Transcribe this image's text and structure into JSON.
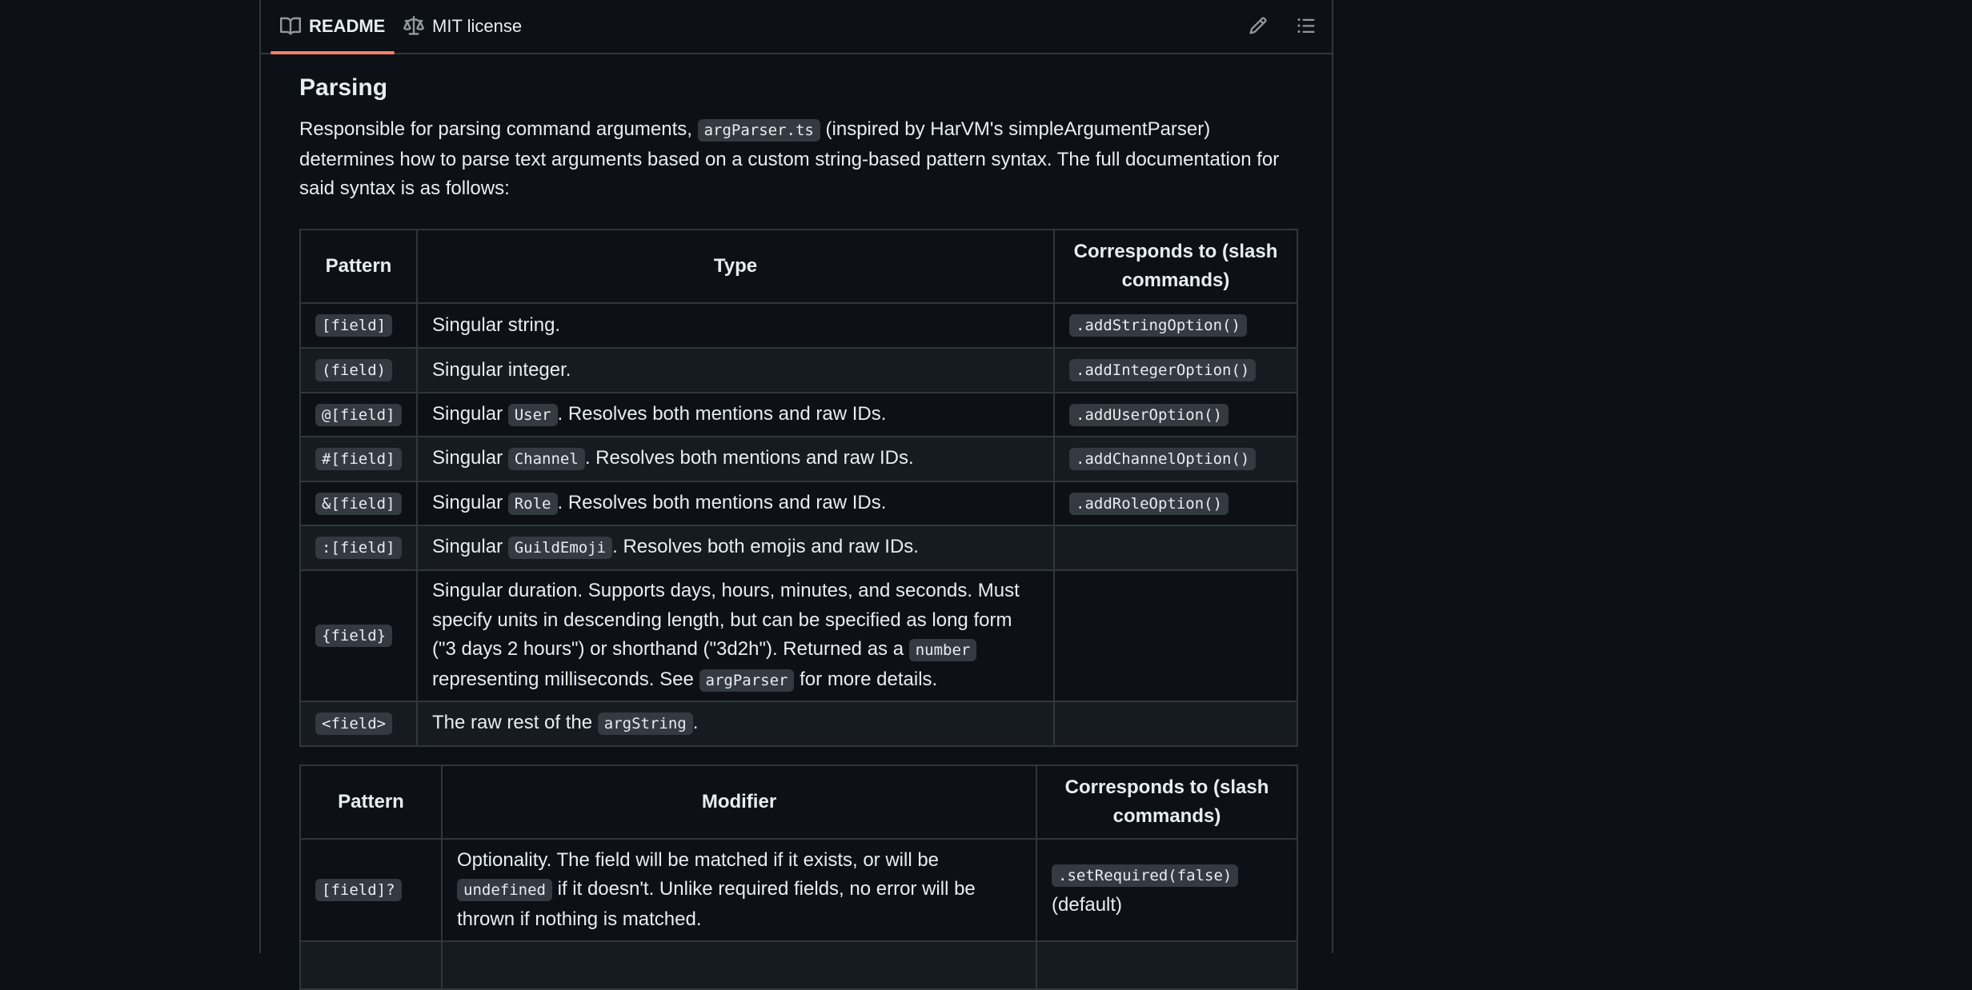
{
  "tabs": {
    "readme": "README",
    "license": "MIT license"
  },
  "icons": {
    "readme": "book-icon",
    "license": "scale-icon",
    "edit": "pencil-icon",
    "outline": "list-icon"
  },
  "colors": {
    "background": "#0d1117",
    "alt_row": "#161b22",
    "border": "#30363d",
    "code_bg": "#343942",
    "active_tab_underline": "#f78166"
  },
  "section": {
    "heading": "Parsing",
    "intro": {
      "t1": "Responsible for parsing command arguments, ",
      "code1": "argParser.ts",
      "t2": " (inspired by HarVM's simpleArgumentParser) determines how to parse text arguments based on a custom string-based pattern syntax. The full documentation for said syntax is as follows:"
    }
  },
  "types_table": {
    "headers": [
      "Pattern",
      "Type",
      "Corresponds to (slash commands)"
    ],
    "rows": [
      {
        "pattern": "[field]",
        "pre": "Singular string.",
        "code": "",
        "post": "",
        "slash": ".addStringOption()"
      },
      {
        "pattern": "(field)",
        "pre": "Singular integer.",
        "code": "",
        "post": "",
        "slash": ".addIntegerOption()"
      },
      {
        "pattern": "@[field]",
        "pre": "Singular ",
        "code": "User",
        "post": ". Resolves both mentions and raw IDs.",
        "slash": ".addUserOption()"
      },
      {
        "pattern": "#[field]",
        "pre": "Singular ",
        "code": "Channel",
        "post": ". Resolves both mentions and raw IDs.",
        "slash": ".addChannelOption()"
      },
      {
        "pattern": "&[field]",
        "pre": "Singular ",
        "code": "Role",
        "post": ". Resolves both mentions and raw IDs.",
        "slash": ".addRoleOption()"
      },
      {
        "pattern": ":[field]",
        "pre": "Singular ",
        "code": "GuildEmoji",
        "post": ". Resolves both emojis and raw IDs.",
        "slash": ""
      },
      {
        "pattern": "{field}",
        "duration": {
          "t1": "Singular duration. Supports days, hours, minutes, and seconds. Must specify units in descending length, but can be specified as long form (\"3 days 2 hours\") or shorthand (\"3d2h\"). Returned as a ",
          "c1": "number",
          "t2": " representing milliseconds. See ",
          "c2": "argParser",
          "t3": " for more details."
        },
        "slash": ""
      },
      {
        "pattern": "<field>",
        "pre": "The raw rest of the ",
        "code": "argString",
        "post": ".",
        "slash": ""
      }
    ]
  },
  "modifiers_table": {
    "headers": [
      "Pattern",
      "Modifier",
      "Corresponds to (slash commands)"
    ],
    "rows": [
      {
        "pattern": "[field]?",
        "m1": "Optionality. The field will be matched if it exists, or will be ",
        "mcode": "undefined",
        "m2": " if it doesn't. Unlike required fields, no error will be thrown if nothing is matched.",
        "slash_code": ".setRequired(false)",
        "slash_text": "(default)"
      }
    ]
  }
}
